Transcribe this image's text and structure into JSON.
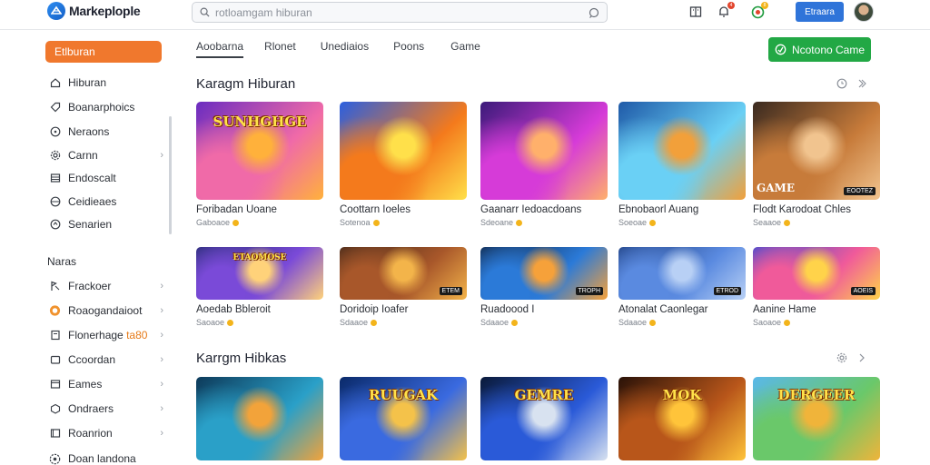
{
  "app": {
    "name": "Markeplople"
  },
  "search": {
    "placeholder": "rotloamgam hiburan"
  },
  "topbar": {
    "button_label": "Etraara",
    "badge_a": "4",
    "badge_b": "8"
  },
  "sidebar": {
    "active": "Etlburan",
    "items": [
      {
        "label": "Hiburan",
        "icon": "home-icon"
      },
      {
        "label": "Boanarphoics",
        "icon": "tag-icon"
      },
      {
        "label": "Neraons",
        "icon": "compass-icon"
      },
      {
        "label": "Carnn",
        "icon": "gear-icon",
        "chevron": true
      },
      {
        "label": "Endoscalt",
        "icon": "list-icon"
      },
      {
        "label": "Ceidieaes",
        "icon": "globe-icon"
      },
      {
        "label": "Senarien",
        "icon": "clock-icon"
      }
    ],
    "section_label": "Naras",
    "section_items": [
      {
        "label": "Frackoer",
        "icon": "flag-icon",
        "chevron": true
      },
      {
        "label": "Roaogandaioot",
        "icon": "coin-icon",
        "chevron": true
      },
      {
        "label": "Flonerhage",
        "highlight": "ta80",
        "icon": "bookmark-icon",
        "chevron": true
      },
      {
        "label": "Ccoordan",
        "icon": "box-icon",
        "chevron": true
      },
      {
        "label": "Eames",
        "icon": "card-icon",
        "chevron": true
      },
      {
        "label": "Ondraers",
        "icon": "cube-icon",
        "chevron": true
      },
      {
        "label": "Roanrion",
        "icon": "window-icon",
        "chevron": true
      },
      {
        "label": "Doan landona",
        "icon": "users-icon"
      }
    ]
  },
  "tabs": [
    "Aoobarna",
    "Rlonet",
    "Unediaios",
    "Poons",
    "Game"
  ],
  "new_game_button": "Ncotono Came",
  "sections": [
    {
      "title": "Karagm Hiburan",
      "rows": [
        [
          {
            "title": "Foribadan Uoane",
            "meta": "Gaboaoe",
            "label": "SUNHGHGE",
            "colors": [
              "#6a2cc0",
              "#f06aa8",
              "#ffb13b"
            ]
          },
          {
            "title": "Coottarn Ioeles",
            "meta": "Sotenoa",
            "label": "",
            "colors": [
              "#2a5fe0",
              "#f47a1c",
              "#ffe04a"
            ]
          },
          {
            "title": "Gaanarr Iedoacdoans",
            "meta": "Sdeoane",
            "label": "",
            "colors": [
              "#3b1a7a",
              "#d63bd8",
              "#ffb06b"
            ]
          },
          {
            "title": "Ebnobaorl Auang",
            "meta": "Soeoae",
            "label": "",
            "colors": [
              "#1f5aa8",
              "#6ad0f5",
              "#f2a03a"
            ]
          },
          {
            "title": "Flodt Karodoat Chles",
            "meta": "Seaaoe",
            "label": "",
            "tag": "GAME",
            "corner": "EOOTEZ",
            "colors": [
              "#3a2a20",
              "#c77b3a",
              "#f1c48f"
            ]
          }
        ],
        [
          {
            "title": "Aoedab Bbleroit",
            "meta": "Saoaoe",
            "label": "ETAOMOSE",
            "colors": [
              "#1e2a6a",
              "#7a4ad8",
              "#ffd27a"
            ]
          },
          {
            "title": "Doridoip Ioafer",
            "meta": "Sdaaoe",
            "label": "",
            "corner": "ETEM",
            "colors": [
              "#3a2418",
              "#a8572a",
              "#f3b44a"
            ]
          },
          {
            "title": "Ruadoood I",
            "meta": "Sdaaoe",
            "label": "",
            "corner": "TROPH",
            "colors": [
              "#0e1f3a",
              "#2b7ad8",
              "#f6a13a"
            ]
          },
          {
            "title": "Atonalat Caonlegar",
            "meta": "Sdaaoe",
            "label": "",
            "corner": "ETROD",
            "colors": [
              "#1a3a7a",
              "#5a8ae0",
              "#b8d0f5"
            ]
          },
          {
            "title": "Aanine Hame",
            "meta": "Saoaoe",
            "label": "",
            "corner": "AOEIS",
            "colors": [
              "#2a4ad8",
              "#f05a9a",
              "#ffd34a"
            ]
          }
        ]
      ]
    },
    {
      "title": "Karrgm Hibkas",
      "rows": [
        [
          {
            "title": "",
            "meta": "",
            "label": "",
            "colors": [
              "#0d3a5a",
              "#2aa0c8",
              "#f2a33a"
            ]
          },
          {
            "title": "",
            "meta": "",
            "label": "RUUGAK",
            "colors": [
              "#0a2a6a",
              "#3a6ae0",
              "#f4c24a"
            ]
          },
          {
            "title": "",
            "meta": "",
            "label": "GEMRE",
            "colors": [
              "#0a1a3a",
              "#2a5ad8",
              "#d8e2f0"
            ]
          },
          {
            "title": "",
            "meta": "",
            "label": "MOK",
            "colors": [
              "#2a1208",
              "#b8561a",
              "#ffc43a"
            ]
          },
          {
            "title": "",
            "meta": "",
            "label": "DERGEER",
            "colors": [
              "#5ab8e8",
              "#6ac86a",
              "#f0b43a"
            ]
          }
        ]
      ]
    }
  ]
}
